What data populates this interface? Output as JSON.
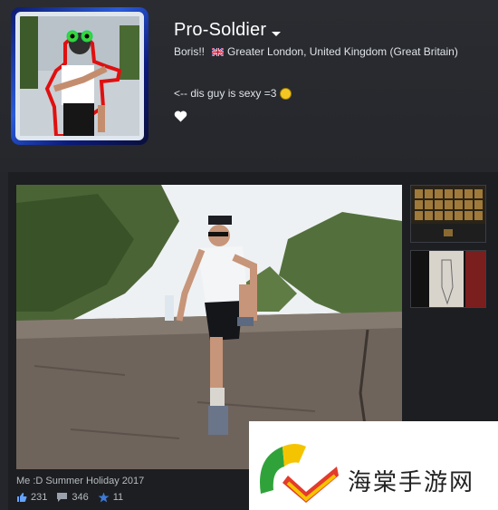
{
  "profile": {
    "name": "Pro-Soldier",
    "real_name": "Boris!!",
    "location": "Greater London, United Kingdom (Great Britain)",
    "summary": "<-- dis guy is sexy =3"
  },
  "showcase": {
    "caption": "Me :D Summer Holiday 2017",
    "stats": {
      "likes": "231",
      "comments": "346",
      "awards": "11"
    }
  },
  "watermark": {
    "text": "海棠手游网"
  },
  "colors": {
    "background": "#24262b",
    "name": "#ffffff",
    "text": "#dfe3e6",
    "avatar_frame": "#2a5bd8"
  }
}
